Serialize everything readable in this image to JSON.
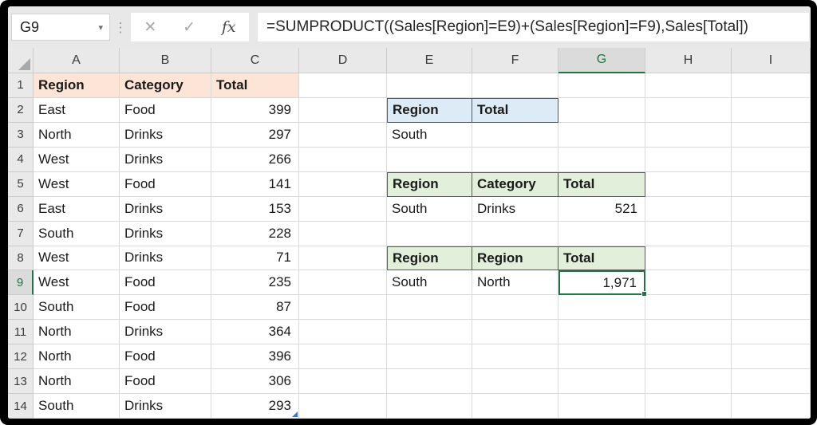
{
  "toolbar": {
    "name_box_value": "G9",
    "dropdown_icon": "▾",
    "separator_icon": "⋮",
    "cancel_icon": "✕",
    "enter_icon": "✓",
    "insert_function_icon": "fx",
    "formula": "=SUMPRODUCT((Sales[Region]=E9)+(Sales[Region]=F9),Sales[Total])"
  },
  "colors": {
    "accent_green": "#217346",
    "peach_fill": "#FCE4D6",
    "blue_fill": "#DDEBF7",
    "green_fill": "#E2EFDA",
    "table_end_marker_blue": "#4472C4"
  },
  "sheet": {
    "column_headers": [
      "A",
      "B",
      "C",
      "D",
      "E",
      "F",
      "G",
      "H",
      "I"
    ],
    "row_count": 14,
    "selected_cell": "G9",
    "selected_column": "G",
    "selected_row": 9,
    "tables": [
      {
        "name": "sales-table",
        "origin": "A1",
        "headers": [
          "Region",
          "Category",
          "Total"
        ],
        "header_fill": "#FCE4D6",
        "header_border": false,
        "end_marker_cell": "C14",
        "rows": [
          [
            "East",
            "Food",
            "399"
          ],
          [
            "North",
            "Drinks",
            "297"
          ],
          [
            "West",
            "Drinks",
            "266"
          ],
          [
            "West",
            "Food",
            "141"
          ],
          [
            "East",
            "Drinks",
            "153"
          ],
          [
            "South",
            "Drinks",
            "228"
          ],
          [
            "West",
            "Drinks",
            "71"
          ],
          [
            "West",
            "Food",
            "235"
          ],
          [
            "South",
            "Food",
            "87"
          ],
          [
            "North",
            "Drinks",
            "364"
          ],
          [
            "North",
            "Food",
            "396"
          ],
          [
            "North",
            "Food",
            "306"
          ],
          [
            "South",
            "Drinks",
            "293"
          ]
        ]
      },
      {
        "name": "criteria-block-1",
        "origin": "E2",
        "headers": [
          "Region",
          "Total"
        ],
        "header_fill": "#DDEBF7",
        "header_border": true,
        "rows": [
          [
            "South",
            ""
          ]
        ]
      },
      {
        "name": "criteria-block-2",
        "origin": "E5",
        "headers": [
          "Region",
          "Category",
          "Total"
        ],
        "header_fill": "#E2EFDA",
        "header_border": true,
        "rows": [
          [
            "South",
            "Drinks",
            "521"
          ]
        ]
      },
      {
        "name": "criteria-block-3",
        "origin": "E8",
        "headers": [
          "Region",
          "Region",
          "Total"
        ],
        "header_fill": "#E2EFDA",
        "header_border": true,
        "rows": [
          [
            "South",
            "North",
            "1,971"
          ]
        ]
      }
    ]
  }
}
